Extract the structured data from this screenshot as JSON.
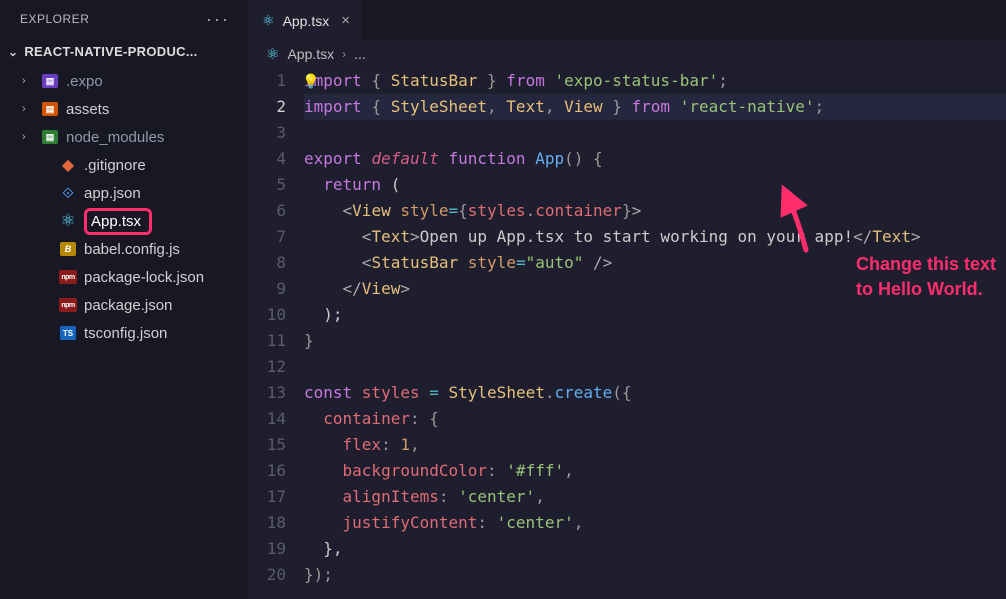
{
  "explorer_label": "EXPLORER",
  "project_name": "REACT-NATIVE-PRODUC...",
  "tree": [
    {
      "name": ".expo",
      "icon": "expo-folder-icon",
      "folder": true,
      "expanded": false,
      "muted": true
    },
    {
      "name": "assets",
      "icon": "assets-folder-icon",
      "folder": true,
      "expanded": false
    },
    {
      "name": "node_modules",
      "icon": "node-modules-folder-icon",
      "folder": true,
      "expanded": false,
      "muted": true
    },
    {
      "name": ".gitignore",
      "icon": "git-icon",
      "folder": false
    },
    {
      "name": "app.json",
      "icon": "json-app-icon",
      "folder": false
    },
    {
      "name": "App.tsx",
      "icon": "react-icon",
      "folder": false,
      "selected": true
    },
    {
      "name": "babel.config.js",
      "icon": "babel-icon",
      "folder": false
    },
    {
      "name": "package-lock.json",
      "icon": "npm-icon",
      "folder": false
    },
    {
      "name": "package.json",
      "icon": "npm-icon",
      "folder": false
    },
    {
      "name": "tsconfig.json",
      "icon": "ts-icon",
      "folder": false
    }
  ],
  "tab": {
    "label": "App.tsx",
    "icon": "react-icon"
  },
  "breadcrumb": {
    "file": "App.tsx",
    "sep": "›",
    "rest": "..."
  },
  "code": {
    "current_line": 2,
    "lines": [
      {
        "n": 1,
        "tokens": [
          [
            "bulb",
            ""
          ],
          [
            "tok-kw",
            "import "
          ],
          [
            "tok-punc",
            "{ "
          ],
          [
            "tok-comp",
            "StatusBar"
          ],
          [
            "tok-punc",
            " }"
          ],
          [
            "tok-kw",
            " from "
          ],
          [
            "tok-str",
            "'expo-status-bar'"
          ],
          [
            "tok-punc",
            ";"
          ]
        ]
      },
      {
        "n": 2,
        "hl": true,
        "tokens": [
          [
            "tok-kw",
            "import "
          ],
          [
            "tok-punc",
            "{ "
          ],
          [
            "tok-comp",
            "StyleSheet"
          ],
          [
            "tok-punc",
            ", "
          ],
          [
            "tok-comp",
            "Text"
          ],
          [
            "tok-punc",
            ", "
          ],
          [
            "tok-comp",
            "View"
          ],
          [
            "tok-punc",
            " }"
          ],
          [
            "tok-kw",
            " from "
          ],
          [
            "tok-str",
            "'react-native'"
          ],
          [
            "tok-punc",
            ";"
          ]
        ]
      },
      {
        "n": 3,
        "tokens": []
      },
      {
        "n": 4,
        "tokens": [
          [
            "tok-kw",
            "export "
          ],
          [
            "tok-def",
            "default "
          ],
          [
            "tok-kw",
            "function "
          ],
          [
            "tok-fn",
            "App"
          ],
          [
            "tok-punc",
            "() "
          ],
          [
            "tok-punc",
            "{"
          ]
        ]
      },
      {
        "n": 5,
        "tokens": [
          [
            "tok-plain",
            "  "
          ],
          [
            "tok-kw",
            "return"
          ],
          [
            "tok-plain",
            " ("
          ]
        ]
      },
      {
        "n": 6,
        "tokens": [
          [
            "tok-plain",
            "    "
          ],
          [
            "tok-opn",
            "<"
          ],
          [
            "tok-comp",
            "View"
          ],
          [
            "tok-plain",
            " "
          ],
          [
            "tok-prop",
            "style"
          ],
          [
            "tok-eq",
            "="
          ],
          [
            "tok-punc",
            "{"
          ],
          [
            "tok-var",
            "styles"
          ],
          [
            "tok-punc",
            "."
          ],
          [
            "tok-var",
            "container"
          ],
          [
            "tok-punc",
            "}"
          ],
          [
            "tok-opn",
            ">"
          ]
        ]
      },
      {
        "n": 7,
        "tokens": [
          [
            "tok-plain",
            "      "
          ],
          [
            "tok-opn",
            "<"
          ],
          [
            "tok-comp",
            "Text"
          ],
          [
            "tok-opn",
            ">"
          ],
          [
            "tok-plain",
            "Open up App.tsx to start working on your app!"
          ],
          [
            "tok-opn",
            "</"
          ],
          [
            "tok-comp",
            "Text"
          ],
          [
            "tok-opn",
            ">"
          ]
        ]
      },
      {
        "n": 8,
        "tokens": [
          [
            "tok-plain",
            "      "
          ],
          [
            "tok-opn",
            "<"
          ],
          [
            "tok-comp",
            "StatusBar"
          ],
          [
            "tok-plain",
            " "
          ],
          [
            "tok-prop",
            "style"
          ],
          [
            "tok-eq",
            "="
          ],
          [
            "tok-str",
            "\"auto\""
          ],
          [
            "tok-plain",
            " "
          ],
          [
            "tok-opn",
            "/>"
          ]
        ]
      },
      {
        "n": 9,
        "tokens": [
          [
            "tok-plain",
            "    "
          ],
          [
            "tok-opn",
            "</"
          ],
          [
            "tok-comp",
            "View"
          ],
          [
            "tok-opn",
            ">"
          ]
        ]
      },
      {
        "n": 10,
        "tokens": [
          [
            "tok-plain",
            "  );"
          ]
        ]
      },
      {
        "n": 11,
        "tokens": [
          [
            "tok-punc",
            "}"
          ]
        ]
      },
      {
        "n": 12,
        "tokens": []
      },
      {
        "n": 13,
        "tokens": [
          [
            "tok-kw",
            "const "
          ],
          [
            "tok-var",
            "styles"
          ],
          [
            "tok-plain",
            " "
          ],
          [
            "tok-eq",
            "="
          ],
          [
            "tok-plain",
            " "
          ],
          [
            "tok-comp",
            "StyleSheet"
          ],
          [
            "tok-punc",
            "."
          ],
          [
            "tok-fn",
            "create"
          ],
          [
            "tok-punc",
            "({"
          ]
        ]
      },
      {
        "n": 14,
        "tokens": [
          [
            "tok-plain",
            "  "
          ],
          [
            "tok-var",
            "container"
          ],
          [
            "tok-punc",
            ": {"
          ]
        ]
      },
      {
        "n": 15,
        "tokens": [
          [
            "tok-plain",
            "    "
          ],
          [
            "tok-var",
            "flex"
          ],
          [
            "tok-punc",
            ": "
          ],
          [
            "tok-prop",
            "1"
          ],
          [
            "tok-punc",
            ","
          ]
        ]
      },
      {
        "n": 16,
        "tokens": [
          [
            "tok-plain",
            "    "
          ],
          [
            "tok-var",
            "backgroundColor"
          ],
          [
            "tok-punc",
            ": "
          ],
          [
            "tok-str",
            "'#fff'"
          ],
          [
            "tok-punc",
            ","
          ]
        ]
      },
      {
        "n": 17,
        "tokens": [
          [
            "tok-plain",
            "    "
          ],
          [
            "tok-var",
            "alignItems"
          ],
          [
            "tok-punc",
            ": "
          ],
          [
            "tok-str",
            "'center'"
          ],
          [
            "tok-punc",
            ","
          ]
        ]
      },
      {
        "n": 18,
        "tokens": [
          [
            "tok-plain",
            "    "
          ],
          [
            "tok-var",
            "justifyContent"
          ],
          [
            "tok-punc",
            ": "
          ],
          [
            "tok-str",
            "'center'"
          ],
          [
            "tok-punc",
            ","
          ]
        ]
      },
      {
        "n": 19,
        "tokens": [
          [
            "tok-plain",
            "  },"
          ]
        ]
      },
      {
        "n": 20,
        "tokens": [
          [
            "tok-punc",
            "});"
          ]
        ]
      }
    ]
  },
  "annotation": {
    "line1": "Change this text",
    "line2": "to Hello World.",
    "color": "#ff2d6b"
  }
}
